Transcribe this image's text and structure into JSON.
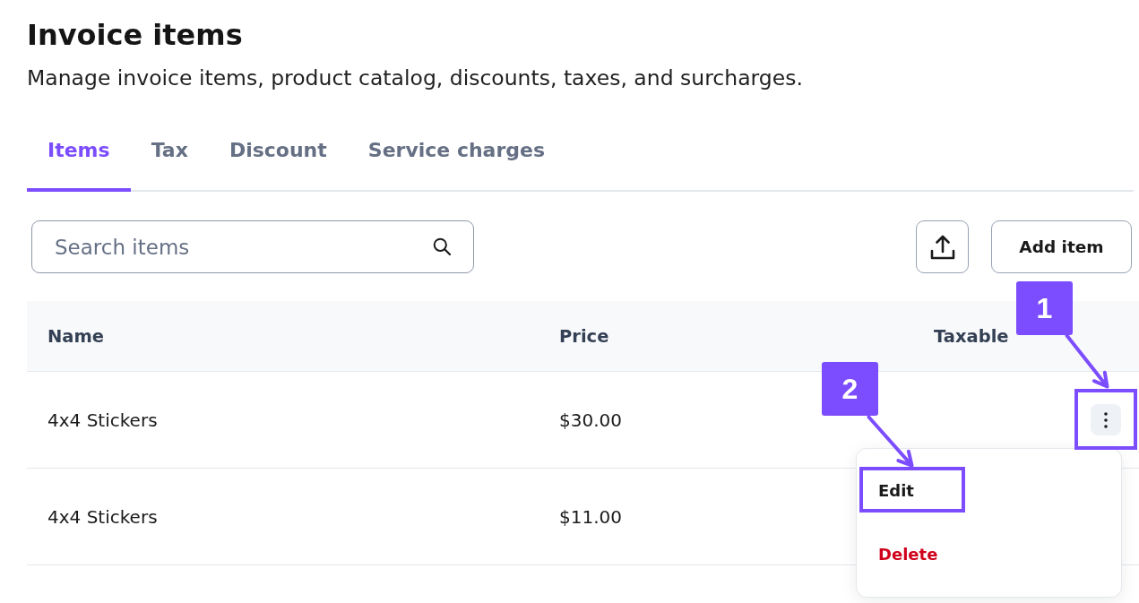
{
  "page": {
    "title": "Invoice items",
    "subtitle": "Manage invoice items, product catalog, discounts, taxes, and surcharges."
  },
  "tabs": [
    {
      "label": "Items",
      "selected": true
    },
    {
      "label": "Tax",
      "selected": false
    },
    {
      "label": "Discount",
      "selected": false
    },
    {
      "label": "Service charges",
      "selected": false
    }
  ],
  "toolbar": {
    "search": {
      "placeholder": "Search items"
    },
    "add_button": "Add item"
  },
  "table": {
    "columns": [
      "Name",
      "Price",
      "Taxable"
    ],
    "rows": [
      {
        "name": "4x4 Stickers",
        "price": "$30.00",
        "menu_open": true,
        "callout": "1"
      },
      {
        "name": "4x4 Stickers",
        "price": "$11.00",
        "menu_open": false
      }
    ],
    "row_menu": [
      {
        "label": "Edit",
        "kind": "default",
        "callout": "2"
      },
      {
        "label": "Delete",
        "kind": "danger"
      }
    ]
  }
}
